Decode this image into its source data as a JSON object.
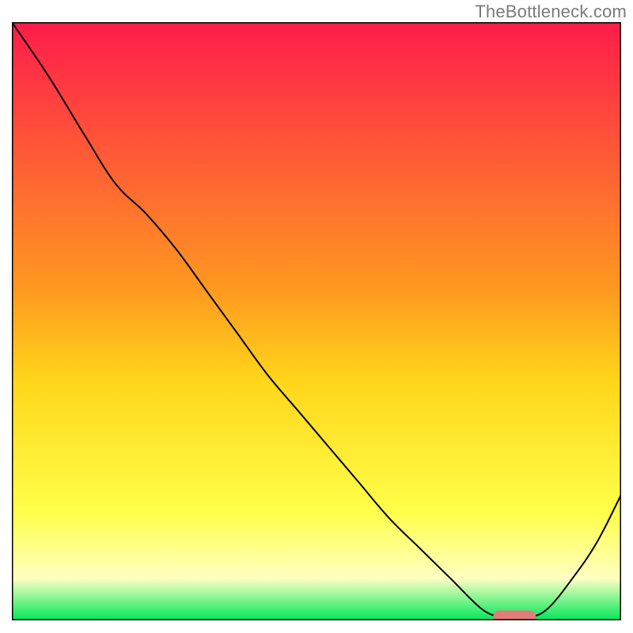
{
  "attribution": "TheBottleneck.com",
  "chart_data": {
    "type": "line",
    "title": "",
    "xlabel": "",
    "ylabel": "",
    "xlim": [
      0,
      100
    ],
    "ylim": [
      0,
      100
    ],
    "x": [
      0,
      6,
      12,
      17,
      22,
      27,
      32,
      37,
      42,
      47,
      52,
      57,
      62,
      67,
      72,
      77,
      80,
      82.5,
      85,
      88,
      92,
      96,
      100
    ],
    "values": [
      100,
      91,
      81,
      73,
      68,
      62,
      55,
      48,
      41,
      35,
      29,
      23,
      17,
      12,
      7,
      2,
      0.6,
      0.4,
      0.5,
      2,
      7,
      13,
      21
    ],
    "curve_color": "#000000",
    "background_gradient_stops": [
      {
        "pos": 0.0,
        "color": "#ff1c4b"
      },
      {
        "pos": 0.45,
        "color": "#ff9a20"
      },
      {
        "pos": 0.6,
        "color": "#ffd61a"
      },
      {
        "pos": 0.82,
        "color": "#ffff4a"
      },
      {
        "pos": 0.93,
        "color": "#ffffc2"
      },
      {
        "pos": 1.0,
        "color": "#00e85a"
      }
    ],
    "marker": {
      "x_min": 79,
      "x_max": 86,
      "y": 0.55,
      "color": "#e47a7a",
      "thickness": 2.2
    }
  }
}
